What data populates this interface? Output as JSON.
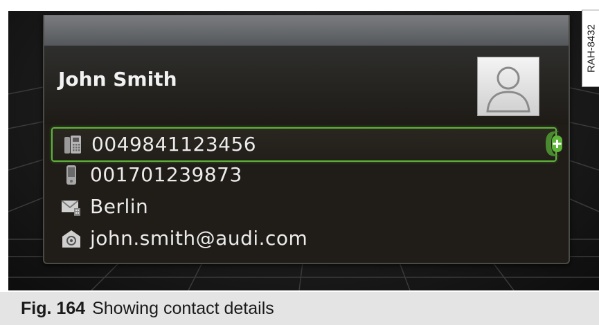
{
  "contact": {
    "name": "John Smith",
    "avatar_icon": "person-silhouette-icon"
  },
  "details": [
    {
      "icon": "landline-phone-icon",
      "value": "0049841123456",
      "selected": true
    },
    {
      "icon": "mobile-phone-icon",
      "value": "001701239873",
      "selected": false
    },
    {
      "icon": "address-envelope-icon",
      "value": "Berlin",
      "selected": false
    },
    {
      "icon": "email-icon",
      "value": "john.smith@audi.com",
      "selected": false
    }
  ],
  "add_button_icon": "plus-icon",
  "accent_color": "#5fb43a",
  "watermark": "RAH-8432",
  "caption": {
    "label": "Fig. 164",
    "text": "Showing contact details"
  }
}
